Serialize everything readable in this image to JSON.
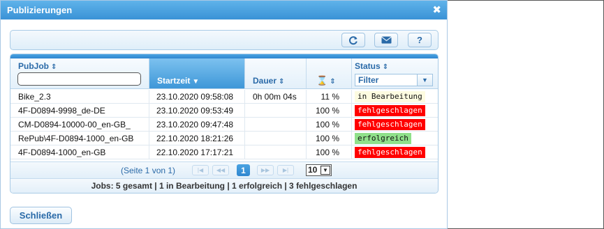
{
  "dialog": {
    "title": "Publizierungen",
    "close_icon": "close-icon",
    "close_button_label": "Schließen"
  },
  "toolbar": {
    "buttons": [
      {
        "name": "refresh-icon",
        "label": ""
      },
      {
        "name": "mail-icon",
        "label": ""
      },
      {
        "name": "help-icon",
        "label": "?"
      }
    ]
  },
  "grid": {
    "columns": {
      "pubjob": "PubJob",
      "startzeit": "Startzeit",
      "dauer": "Dauer",
      "progress_icon": "hourglass-icon",
      "status": "Status"
    },
    "pubjob_filter_value": "",
    "status_filter_value": "Filter",
    "rows": [
      {
        "pubjob": "Bike_2.3",
        "startzeit": "23.10.2020 09:58:08",
        "dauer": "0h 00m 04s",
        "progress": "11 %",
        "status": "in Bearbeitung"
      },
      {
        "pubjob": "4F-D0894-9998_de-DE",
        "startzeit": "23.10.2020 09:53:49",
        "dauer": "",
        "progress": "100 %",
        "status": "fehlgeschlagen"
      },
      {
        "pubjob": "CM-D0894-10000-00_en-GB_",
        "startzeit": "23.10.2020 09:47:48",
        "dauer": "",
        "progress": "100 %",
        "status": "fehlgeschlagen"
      },
      {
        "pubjob": "RePub\\4F-D0894-1000_en-GB",
        "startzeit": "22.10.2020 18:21:26",
        "dauer": "",
        "progress": "100 %",
        "status": "erfolgreich"
      },
      {
        "pubjob": "4F-D0894-1000_en-GB",
        "startzeit": "22.10.2020 17:17:21",
        "dauer": "",
        "progress": "100 %",
        "status": "fehlgeschlagen"
      }
    ],
    "status_colors": {
      "in Bearbeitung": "#fdfbe0",
      "fehlgeschlagen": "#ff0000",
      "erfolgreich": "#8fe08a"
    }
  },
  "pager": {
    "page_text": "(Seite 1 von 1)",
    "current_page": "1",
    "page_size": "10"
  },
  "summary": "Jobs: 5 gesamt | 1 in Bearbeitung | 1 erfolgreich | 3 fehlgeschlagen"
}
